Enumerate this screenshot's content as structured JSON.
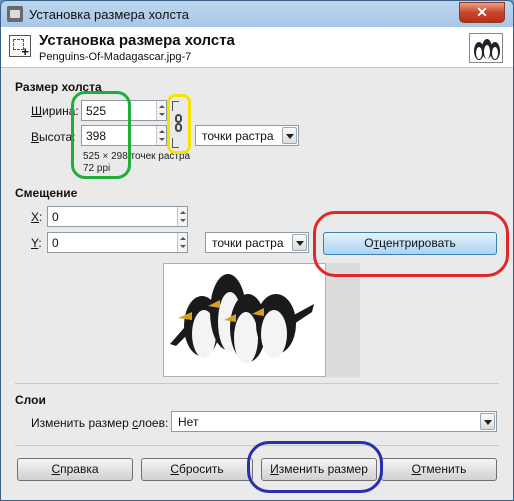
{
  "window": {
    "title": "Установка размера холста",
    "close_glyph": "✕"
  },
  "header": {
    "title": "Установка размера холста",
    "subtitle": "Penguins-Of-Madagascar.jpg-7"
  },
  "canvas_size": {
    "section_label": "Размер холста",
    "width_label": "Ширина:",
    "width_label_mnemonic": "Ш",
    "width_label_rest": "ирина:",
    "width_value": "525",
    "height_label_mnemonic": "В",
    "height_label_rest": "ысота:",
    "height_value": "398",
    "unit": "точки растра",
    "info_size": "525 × 298 точек растра",
    "info_ppi": "72 ppi"
  },
  "offset": {
    "section_label": "Смещение",
    "x_mnemonic": "X",
    "x_value": "0",
    "y_mnemonic": "Y",
    "y_value": "0",
    "unit": "точки растра",
    "center_pre": "О",
    "center_mnemonic": "т",
    "center_post": "центрировать"
  },
  "layers": {
    "section_label": "Слои",
    "resize_pre": "Изменить размер ",
    "resize_mnemonic": "с",
    "resize_post": "лоев:",
    "resize_value": "Нет"
  },
  "buttons": {
    "help_mnemonic": "С",
    "help_rest": "правка",
    "reset_mnemonic": "С",
    "reset_rest": "бросить",
    "resize_mnemonic": "И",
    "resize_rest": "зменить размер",
    "cancel_mnemonic": "О",
    "cancel_rest": "тменить"
  },
  "highlights": {
    "green": "#1fae3a",
    "yellow": "#f2e400",
    "red": "#e0282b",
    "blue": "#2a2fb0"
  }
}
